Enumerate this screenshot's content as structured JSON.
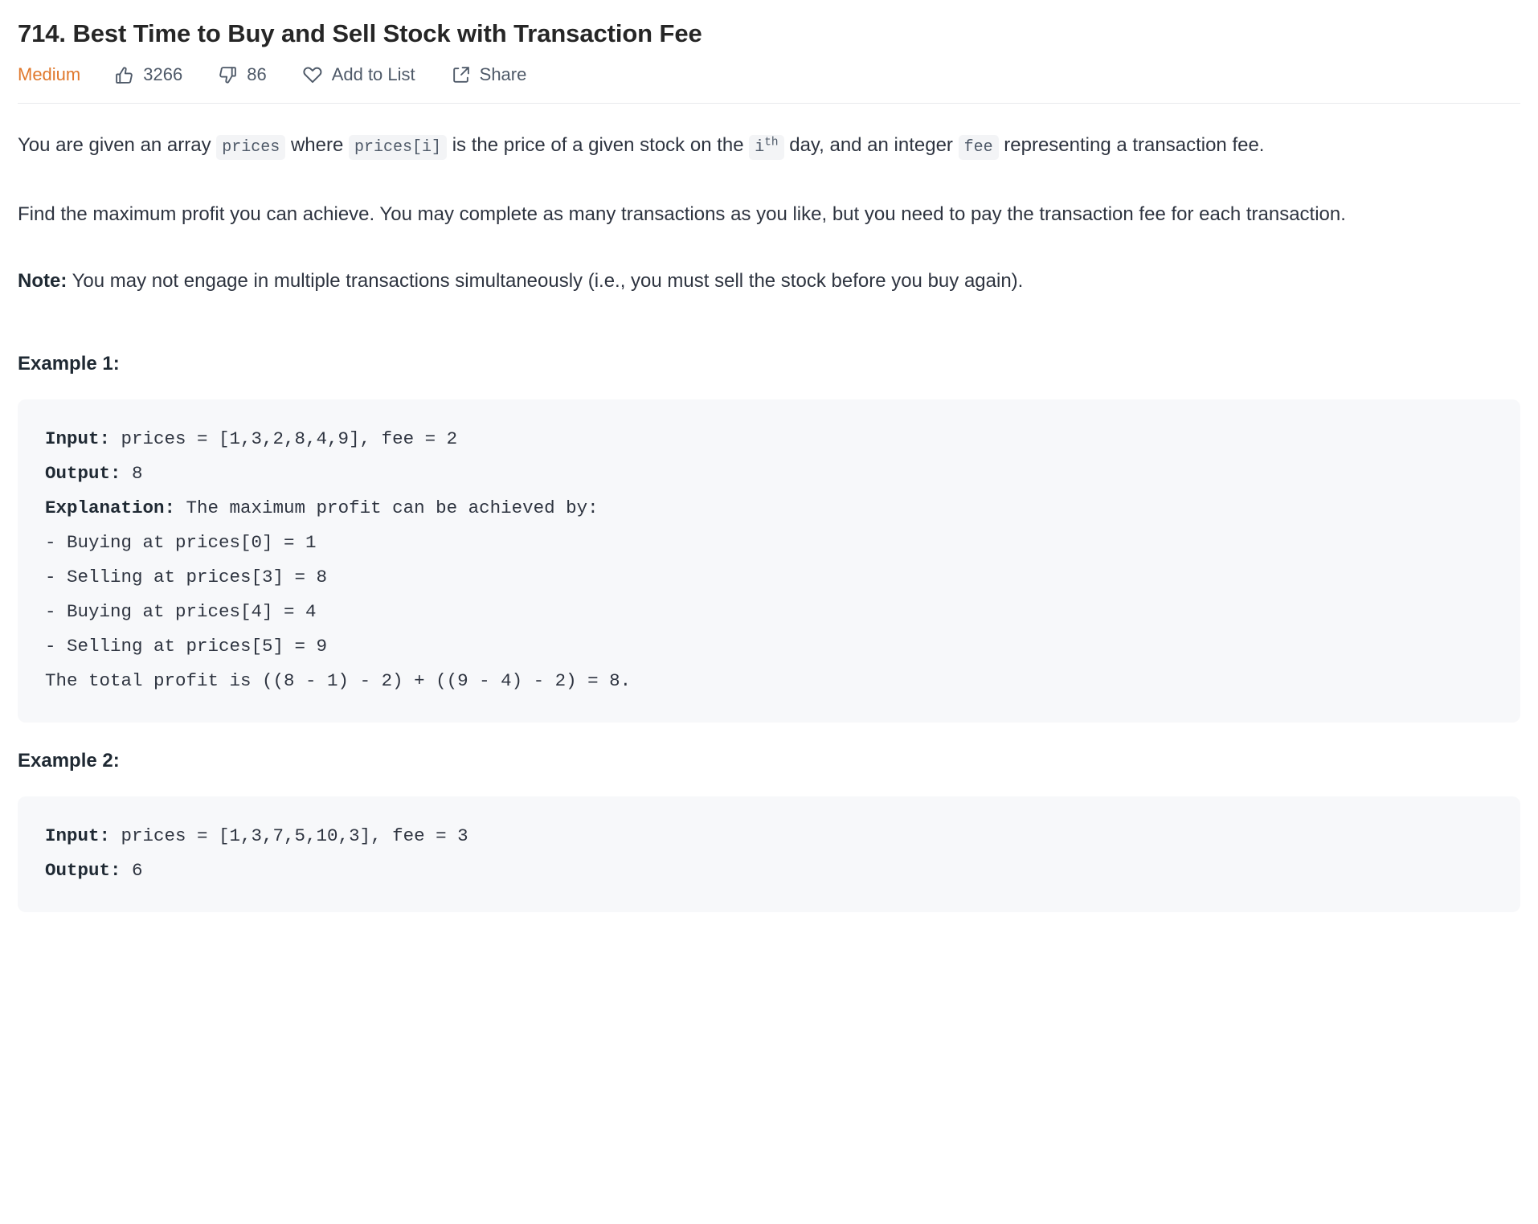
{
  "problem": {
    "title": "714. Best Time to Buy and Sell Stock with Transaction Fee",
    "difficulty": "Medium",
    "difficulty_color": "#e0782c"
  },
  "actions": {
    "likes": "3266",
    "dislikes": "86",
    "add_to_list": "Add to List",
    "share": "Share"
  },
  "description": {
    "p1_a": "You are given an array ",
    "p1_code1": "prices",
    "p1_b": " where ",
    "p1_code2": "prices[i]",
    "p1_c": " is the price of a given stock on the ",
    "p1_code3_base": "i",
    "p1_code3_sup": "th",
    "p1_d": " day, and an integer ",
    "p1_code4": "fee",
    "p1_e": " representing a transaction fee.",
    "p2": "Find the maximum profit you can achieve. You may complete as many transactions as you like, but you need to pay the transaction fee for each transaction.",
    "p3_label": "Note:",
    "p3_text": " You may not engage in multiple transactions simultaneously (i.e., you must sell the stock before you buy again)."
  },
  "examples": [
    {
      "heading": "Example 1:",
      "input_label": "Input:",
      "input_value": " prices = [1,3,2,8,4,9], fee = 2",
      "output_label": "Output:",
      "output_value": " 8",
      "explanation_label": "Explanation:",
      "explanation_value": " The maximum profit can be achieved by:",
      "steps": [
        "- Buying at prices[0] = 1",
        "- Selling at prices[3] = 8",
        "- Buying at prices[4] = 4",
        "- Selling at prices[5] = 9",
        "The total profit is ((8 - 1) - 2) + ((9 - 4) - 2) = 8."
      ]
    },
    {
      "heading": "Example 2:",
      "input_label": "Input:",
      "input_value": " prices = [1,3,7,5,10,3], fee = 3",
      "output_label": "Output:",
      "output_value": " 6"
    }
  ],
  "icons": {
    "thumbs_up": "thumbs-up-icon",
    "thumbs_down": "thumbs-down-icon",
    "heart": "heart-icon",
    "share": "share-icon"
  }
}
